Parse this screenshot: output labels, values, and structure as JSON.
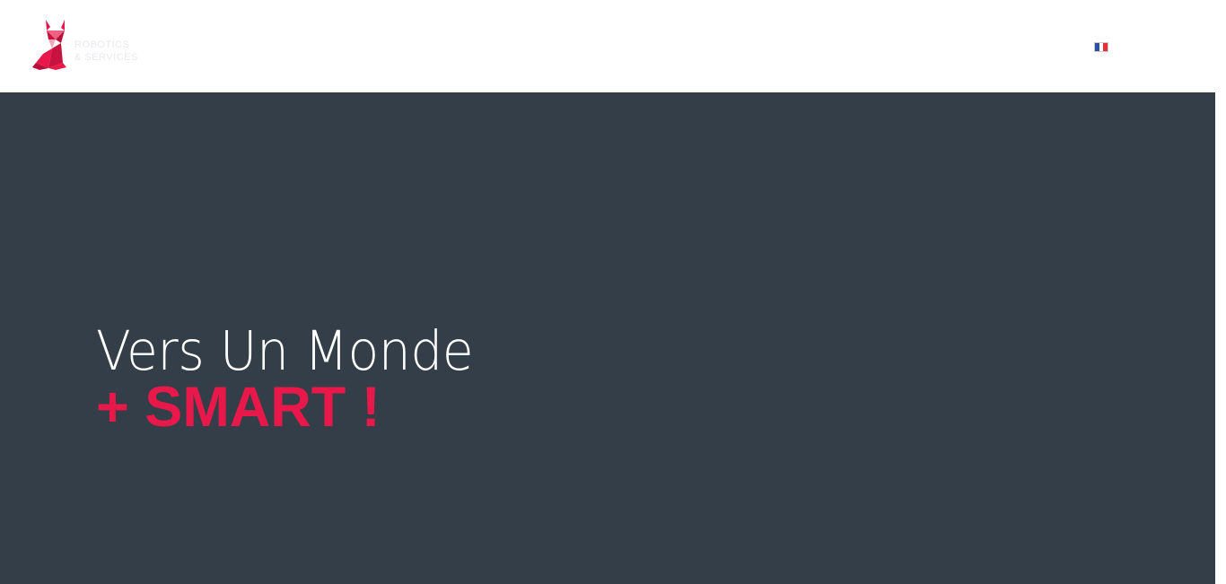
{
  "header": {
    "logo": {
      "line1": "ROBOTICS",
      "line2": "& SERVICES",
      "icon": "fox-origami-icon"
    },
    "language": {
      "icon": "flag-fr-icon",
      "colors": [
        "#2f4ea3",
        "#ffffff",
        "#e3303a"
      ]
    }
  },
  "hero": {
    "headline": "Vers Un Monde",
    "tagline": "+ SMART !",
    "background_color": "#333e48",
    "accent_color": "#e8194a"
  }
}
